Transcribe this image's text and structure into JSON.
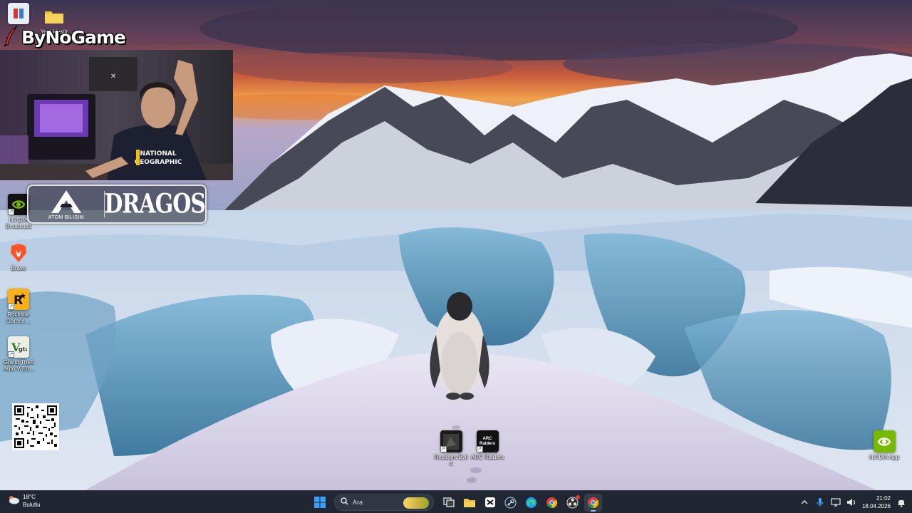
{
  "overlay": {
    "brand_text": "ByNoGame",
    "atom_sub": "ATOM BILISIM",
    "dragos_text": "DRAGOS",
    "shirt_line1": "NATIONAL",
    "shirt_line2": "GEOGRAPHIC"
  },
  "desktop_icons": {
    "tools": {
      "label": ""
    },
    "folder": {
      "label": "Yeni klasör"
    },
    "nvidia_broadcast": {
      "label": "NVIDIA Broadcast"
    },
    "brave": {
      "label": "Brave"
    },
    "rockstar": {
      "label": "Rockstar Games ..."
    },
    "gta": {
      "label": "Grand Theft Auto V En..."
    },
    "resident_evil": {
      "label": "Resident Evil 4"
    },
    "arc_raiders": {
      "label": "ARC Raiders",
      "logo_text": "ARC Raiders"
    },
    "nvidia_app": {
      "label": "NVIDIA App"
    }
  },
  "taskbar": {
    "weather": {
      "temp": "18°C",
      "condition": "Bulutlu"
    },
    "search": {
      "placeholder": "Ara"
    },
    "clock": {
      "time": "21:02",
      "date": "18.04.2026"
    }
  },
  "colors": {
    "taskbar_bg": "#202732",
    "accent": "#8ec6ff",
    "nvidia_green": "#76b900",
    "brave_orange": "#fb542b",
    "rockstar_yellow": "#fcaf17"
  }
}
